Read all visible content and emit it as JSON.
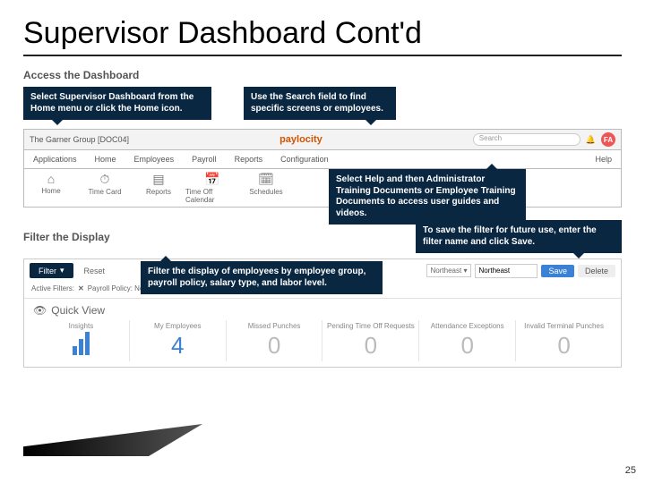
{
  "slide": {
    "title": "Supervisor Dashboard Cont'd",
    "page_number": "25"
  },
  "section1": {
    "label": "Access the Dashboard"
  },
  "callouts": {
    "select_dashboard": "Select Supervisor Dashboard from the Home menu or click the Home icon.",
    "use_search": "Use the Search field to find specific screens or employees.",
    "select_help": "Select Help and then Administrator Training Documents or Employee Training Documents to access user guides and videos.",
    "filter_display": "Filter the display of employees by employee group, payroll policy, salary type, and labor level.",
    "save_filter": "To save the filter for future use, enter the filter name and click Save."
  },
  "topbar": {
    "org": "The Garner Group [DOC04]",
    "logo": "paylocity",
    "search_placeholder": "Search",
    "avatar": "FA"
  },
  "tabs": [
    "Applications",
    "Home",
    "Employees",
    "Payroll",
    "Reports",
    "Configuration"
  ],
  "help_tab": "Help",
  "iconrow": [
    {
      "icon": "⌂",
      "label": "Home"
    },
    {
      "icon": "⏱",
      "label": "Time Card"
    },
    {
      "icon": "▤",
      "label": "Reports"
    },
    {
      "icon": "📅",
      "label": "Time Off Calendar"
    },
    {
      "icon": "🗓",
      "label": "Schedules"
    }
  ],
  "section2": {
    "label": "Filter the Display"
  },
  "filter": {
    "button": "Filter",
    "reset": "Reset",
    "saved_select": "Northeast",
    "name_input": "Northeast",
    "save": "Save",
    "delete": "Delete",
    "active_label": "Active Filters:",
    "active_value": "Payroll Policy: Northeast"
  },
  "quickview": {
    "title": "Quick View",
    "cells": [
      {
        "label": "Insights",
        "value": ""
      },
      {
        "label": "My Employees",
        "value": "4"
      },
      {
        "label": "Missed Punches",
        "value": "0"
      },
      {
        "label": "Pending Time Off Requests",
        "value": "0"
      },
      {
        "label": "Attendance Exceptions",
        "value": "0"
      },
      {
        "label": "Invalid Terminal Punches",
        "value": "0"
      }
    ]
  }
}
